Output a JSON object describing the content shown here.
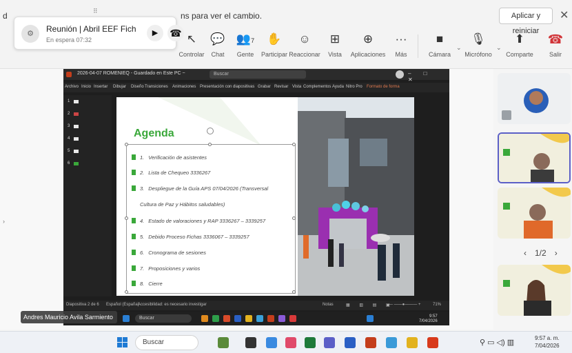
{
  "notification": {
    "lead_char": "d",
    "message": "ns para ver el cambio.",
    "apply_button": "Aplicar y reiniciar",
    "close_glyph": "✕"
  },
  "mini_call": {
    "title": "Reunión | Abril EEF Fich",
    "status": "En espera  07:32",
    "play_glyph": "▶",
    "hangup_glyph": "☎",
    "handle_glyph": "⠿"
  },
  "toolbar": {
    "items": [
      {
        "label": "Controlar",
        "icon": "↖"
      },
      {
        "label": "Chat",
        "icon": "💬"
      },
      {
        "label": "Gente",
        "icon": "👥"
      },
      {
        "label": "Participar",
        "icon": "✋"
      },
      {
        "label": "Reaccionar",
        "icon": "☺"
      },
      {
        "label": "Vista",
        "icon": "⊞"
      },
      {
        "label": "Aplicaciones",
        "icon": "⊕"
      },
      {
        "label": "Más",
        "icon": "···"
      },
      {
        "label": "Cámara",
        "icon": "■"
      },
      {
        "label": "Micrófono",
        "icon": "🎙"
      },
      {
        "label": "Comparte",
        "icon": "⬆"
      },
      {
        "label": "Salir",
        "icon": "☎"
      }
    ],
    "people_count": "7"
  },
  "powerpoint": {
    "filename": "2026-04-07 ROMENIEQ - Guardado en Este PC ~",
    "search_placeholder": "Buscar",
    "window_controls": "– □ ✕",
    "ribbon_tabs": [
      "Archivo",
      "Inicio",
      "Insertar",
      "Dibujar",
      "Diseño",
      "Transiciones",
      "Animaciones",
      "Presentación con diapositivas",
      "Grabar",
      "Revisar",
      "Vista",
      "Complementos",
      "Ayuda",
      "Nitro Pro",
      "Formato de forma"
    ],
    "slide_numbers": [
      "1",
      "2",
      "3",
      "4",
      "5",
      "6"
    ],
    "slide": {
      "title": "Agenda",
      "items": [
        {
          "num": "1.",
          "text": "Verificación de asistentes"
        },
        {
          "num": "2.",
          "text": "Lista de Chequeo 3336267"
        },
        {
          "num": "3.",
          "text": "Despliegue de la Guía APS 07/04/2026 (Transversal"
        },
        {
          "num": "",
          "text": "Cultura de Paz y Hábitos saludables)"
        },
        {
          "num": "4.",
          "text": "Estado de valoraciones y RAP 3336267 – 3339257"
        },
        {
          "num": "5.",
          "text": "Debido Proceso Fichas 3336067 – 3339257"
        },
        {
          "num": "6.",
          "text": "Cronograma de sesiones"
        },
        {
          "num": "7.",
          "text": "Proposiciones y varios"
        },
        {
          "num": "8.",
          "text": "Cierre"
        }
      ]
    },
    "status": {
      "left": "Diapositiva 2 de 6",
      "lang": "Español (España)",
      "access": "Accesibilidad: es necesario investigar",
      "notes": "Notas",
      "zoom": "71%"
    },
    "taskbar": {
      "search": "Buscar",
      "time": "9:57",
      "date": "7/04/2026"
    }
  },
  "presenter_name": "Andres Mauricio Avila Sarmiento",
  "participants": {
    "pager": "1/2",
    "prev_glyph": "‹",
    "next_glyph": "›"
  },
  "os_taskbar": {
    "search": "Buscar",
    "time": "9:57 a. m.",
    "date": "7/04/2026"
  },
  "colors": {
    "agenda_green": "#3aa83a",
    "leave_red": "#d13438",
    "teams_purple": "#5b5fc7"
  }
}
